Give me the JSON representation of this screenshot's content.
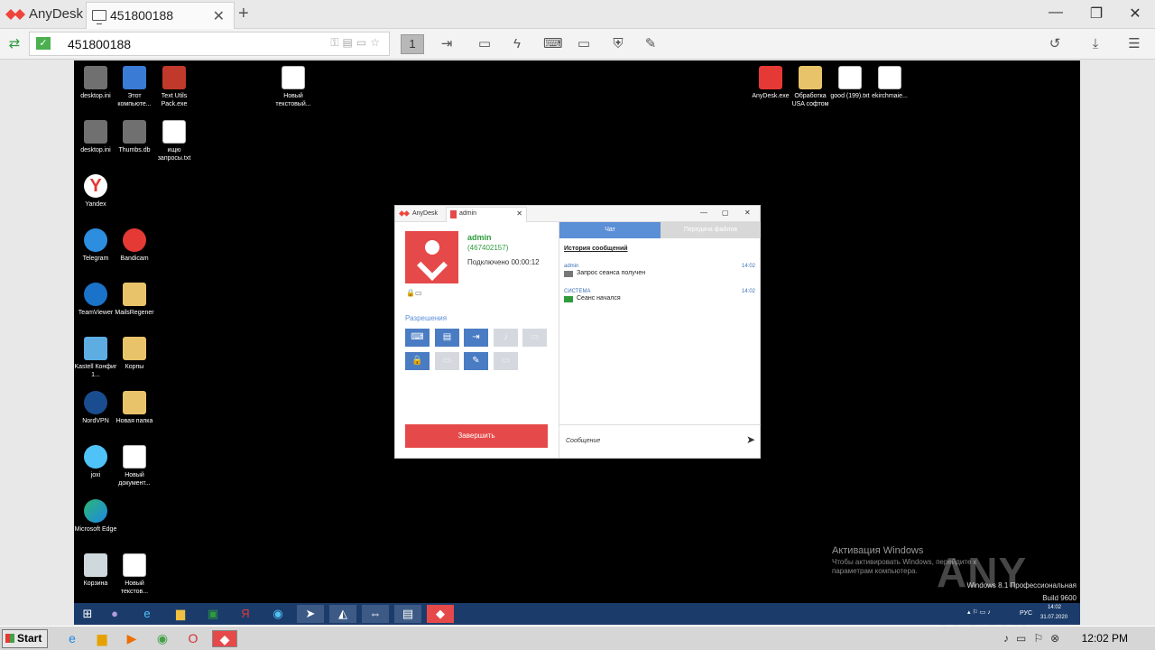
{
  "app": {
    "name": "AnyDesk",
    "tab_title": "451800188",
    "new_tab": "+"
  },
  "window_controls": {
    "minimize": "—",
    "maximize": "❐",
    "close": "✕"
  },
  "address": {
    "value": "451800188"
  },
  "toolbar": {
    "monitor_number": "1"
  },
  "desktop": {
    "icons_left": [
      {
        "label": "desktop.ini",
        "type": "gear"
      },
      {
        "label": "Этот компьюте...",
        "type": "computer"
      },
      {
        "label": "Text Utils Pack.exe",
        "type": "app"
      },
      {
        "label": "desktop.ini",
        "type": "gear"
      },
      {
        "label": "Thumbs.db",
        "type": "gear"
      },
      {
        "label": "ищю запросы.txt",
        "type": "file"
      },
      {
        "label": "Yandex",
        "type": "yandex"
      },
      {
        "label": "Telegram",
        "type": "telegram"
      },
      {
        "label": "Bandicam",
        "type": "bandicam"
      },
      {
        "label": "TeamViewer",
        "type": "teamviewer"
      },
      {
        "label": "MailsRegener",
        "type": "folder"
      },
      {
        "label": "Kastell Конфиг 1...",
        "type": "app"
      },
      {
        "label": "Корпы",
        "type": "folder"
      },
      {
        "label": "NordVPN",
        "type": "nordvpn"
      },
      {
        "label": "Новая папка",
        "type": "folder"
      },
      {
        "label": "joxi",
        "type": "joxi"
      },
      {
        "label": "Новый документ...",
        "type": "file"
      },
      {
        "label": "Microsoft Edge",
        "type": "edge"
      },
      {
        "label": "Корзина",
        "type": "bin"
      },
      {
        "label": "Новый текстов...",
        "type": "file"
      }
    ],
    "icon_center": {
      "label": "Новый текстовый..."
    },
    "icons_right": [
      {
        "label": "AnyDesk.exe",
        "type": "anydesk"
      },
      {
        "label": "Обработка USA софтом",
        "type": "folder"
      },
      {
        "label": "good (199).txt",
        "type": "file"
      },
      {
        "label": "ekirchmaie...",
        "type": "file"
      }
    ]
  },
  "inner_window": {
    "app_name": "AnyDesk",
    "tab_label": "admin",
    "user_name": "admin",
    "user_id": "(467402157)",
    "status": "Подключено 00:00:12",
    "permissions_title": "Разрешения",
    "end_button": "Завершить",
    "tabs": {
      "chat": "Чат",
      "file_transfer": "Передача файлов"
    },
    "history_title": "История сообщений",
    "messages": [
      {
        "sender": "admin",
        "time": "14:02",
        "text": "Запрос сеанса получен"
      },
      {
        "sender": "СИСТЕМА",
        "time": "14:02",
        "text": "Сеанс начался"
      }
    ],
    "message_placeholder": "Сообщение"
  },
  "remote_taskbar": {
    "lang": "РУС",
    "time": "14:02",
    "date": "31.07.2020"
  },
  "watermark": {
    "activation_title": "Активация Windows",
    "activation_text": "Чтобы активировать Windows, перейдите к параметрам компьютера.",
    "edition": "Windows 8.1 Профессиональная",
    "build": "Build 9600",
    "anyrun": "ANY RUN"
  },
  "local_taskbar": {
    "start": "Start",
    "clock": "12:02 PM"
  },
  "colors": {
    "accent_red": "#e64949",
    "permission_blue": "#4a7cc4",
    "chat_tab_blue": "#5b8fd6",
    "user_green": "#2e9b3c"
  }
}
